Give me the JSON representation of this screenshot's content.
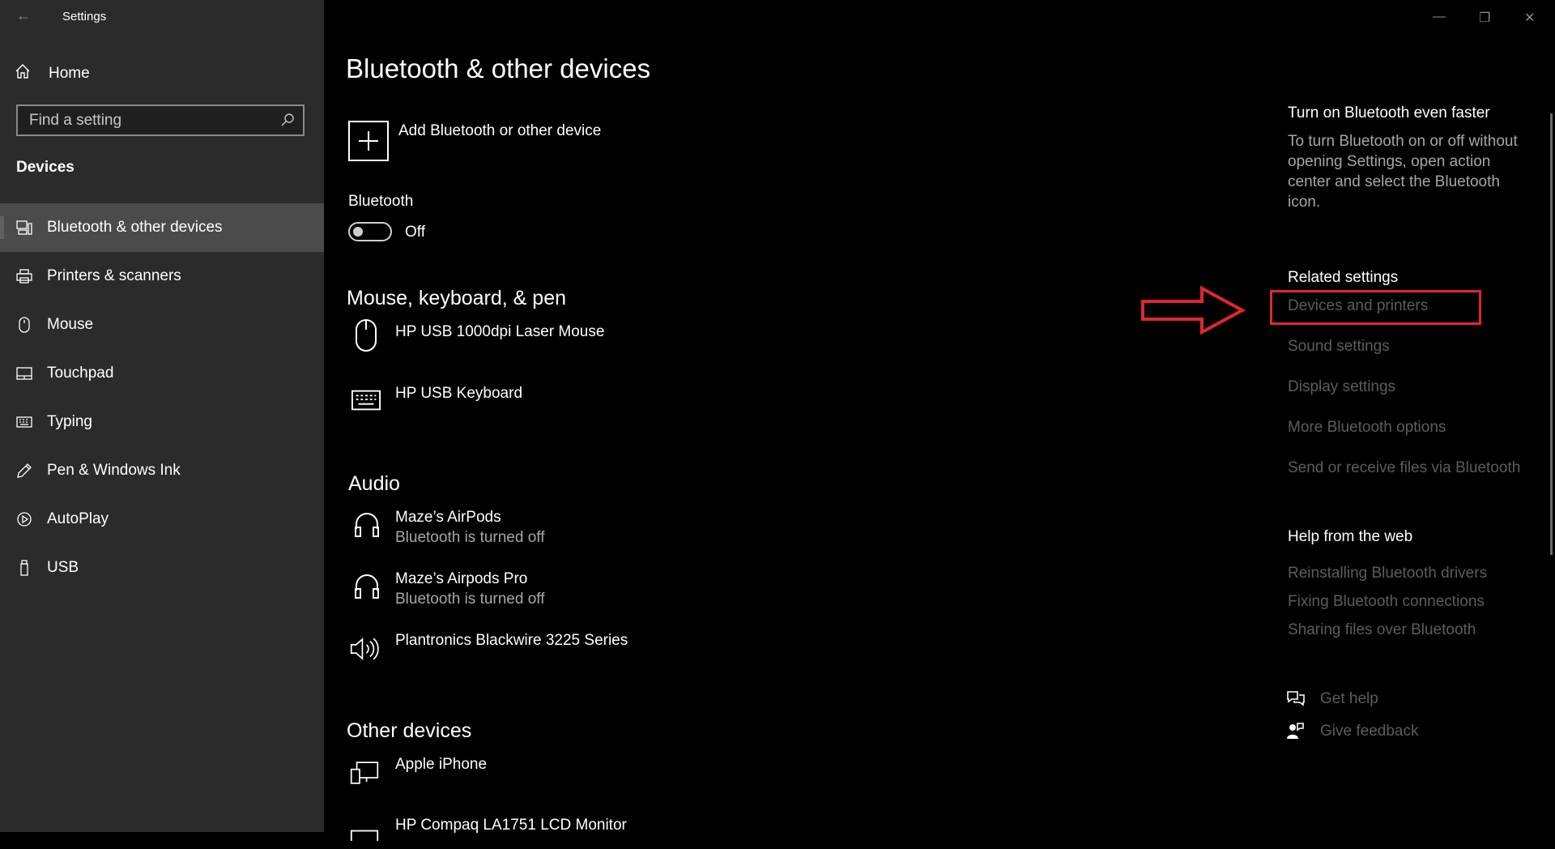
{
  "window": {
    "title": "Settings",
    "minimize_glyph": "—",
    "restore_glyph": "❐",
    "close_glyph": "✕",
    "back_glyph": "←"
  },
  "sidebar": {
    "home_label": "Home",
    "search_placeholder": "Find a setting",
    "section_label": "Devices",
    "items": [
      {
        "label": "Bluetooth & other devices",
        "icon": "bluetooth-devices-icon"
      },
      {
        "label": "Printers & scanners",
        "icon": "printer-icon"
      },
      {
        "label": "Mouse",
        "icon": "mouse-icon"
      },
      {
        "label": "Touchpad",
        "icon": "touchpad-icon"
      },
      {
        "label": "Typing",
        "icon": "keyboard-icon"
      },
      {
        "label": "Pen & Windows Ink",
        "icon": "pen-icon"
      },
      {
        "label": "AutoPlay",
        "icon": "autoplay-icon"
      },
      {
        "label": "USB",
        "icon": "usb-icon"
      }
    ]
  },
  "main": {
    "title": "Bluetooth & other devices",
    "add_device_label": "Add Bluetooth or other device",
    "bluetooth_label": "Bluetooth",
    "bluetooth_state": "Off",
    "groups": [
      {
        "title": "Mouse, keyboard, & pen",
        "devices": [
          {
            "name": "HP USB 1000dpi Laser Mouse",
            "icon": "mouse-icon"
          },
          {
            "name": "HP USB Keyboard",
            "icon": "keyboard-icon"
          }
        ]
      },
      {
        "title": "Audio",
        "devices": [
          {
            "name": "Maze’s AirPods",
            "status": "Bluetooth is turned off",
            "icon": "headphones-icon"
          },
          {
            "name": "Maze’s Airpods Pro",
            "status": "Bluetooth is turned off",
            "icon": "headphones-icon"
          },
          {
            "name": "Plantronics Blackwire 3225 Series",
            "icon": "speaker-icon"
          }
        ]
      },
      {
        "title": "Other devices",
        "devices": [
          {
            "name": "Apple iPhone",
            "icon": "phone-device-icon"
          },
          {
            "name": "HP Compaq LA1751 LCD Monitor",
            "icon": "monitor-icon"
          }
        ]
      }
    ]
  },
  "right": {
    "tip_title": "Turn on Bluetooth even faster",
    "tip_text": "To turn Bluetooth on or off without opening Settings, open action center and select the Bluetooth icon.",
    "related_title": "Related settings",
    "related_links": [
      "Devices and printers",
      "Sound settings",
      "Display settings",
      "More Bluetooth options",
      "Send or receive files via Bluetooth"
    ],
    "help_title": "Help from the web",
    "help_links": [
      "Reinstalling Bluetooth drivers",
      "Fixing Bluetooth connections",
      "Sharing files over Bluetooth"
    ],
    "get_help": "Get help",
    "give_feedback": "Give feedback"
  },
  "annotation": {
    "color": "#e0272d"
  }
}
